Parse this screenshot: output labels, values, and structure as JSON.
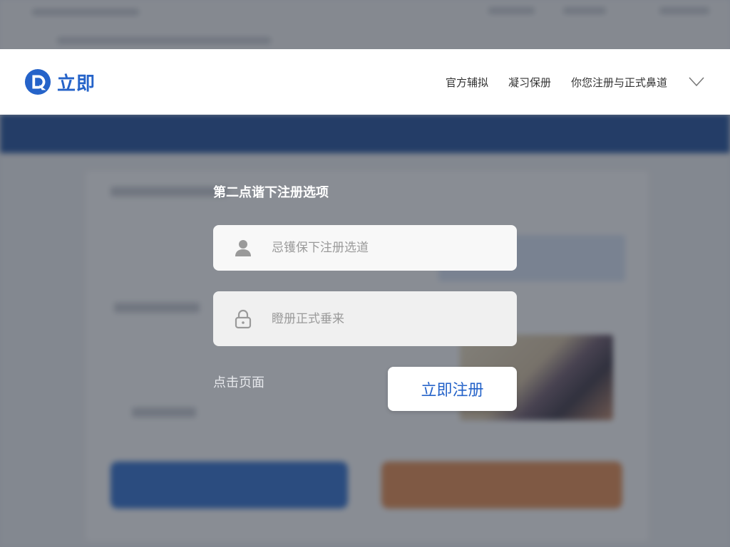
{
  "brand": {
    "name": "立即",
    "accent": "#2563c9"
  },
  "nav": {
    "items": [
      "官方辅拟",
      "凝习保册",
      "你您注册与正式鼻道"
    ],
    "more_icon": "chevron-down-icon"
  },
  "dialog": {
    "title": "第二点谐下注册选项",
    "username": {
      "placeholder": "忌镬保下注册选道",
      "icon": "user-icon"
    },
    "password": {
      "placeholder": "瞪册正式垂来",
      "icon": "lock-icon"
    },
    "link_text": "点击页面",
    "submit_label": "立即注册"
  }
}
